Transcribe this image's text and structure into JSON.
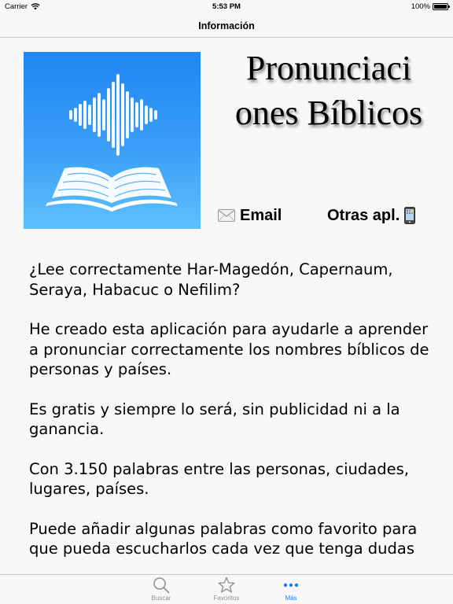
{
  "status_bar": {
    "carrier": "Carrier",
    "time": "5:53 PM",
    "battery": "100%"
  },
  "nav": {
    "title": "Información"
  },
  "app": {
    "title_line1": "Pronunciaci",
    "title_line2": "ones Bíblicos",
    "icon": "book-waveform-icon",
    "icon_colors": [
      "#1f86f3",
      "#5ec0fc"
    ]
  },
  "actions": {
    "email_label": "Email",
    "email_icon": "envelope-icon",
    "other_label": "Otras apl.",
    "other_icon": "phone-icon"
  },
  "description": [
    "¿Lee correctamente Har-Magedón, Capernaum, Seraya, Habacuc o Nefilim?",
    "He creado esta aplicación para ayudarle a aprender a pronunciar correctamente los nombres bíblicos de personas y países.",
    "Es gratis y siempre lo será, sin publicidad ni a la ganancia.",
    "Con 3.150 palabras entre las personas, ciudades, lugares, países.",
    "Puede añadir algunas palabras como favorito para que pueda escucharlos cada vez que tenga dudas"
  ],
  "tabs": [
    {
      "label": "Buscar",
      "icon": "search-icon",
      "active": false
    },
    {
      "label": "Favoritos",
      "icon": "star-icon",
      "active": false
    },
    {
      "label": "Más",
      "icon": "more-icon",
      "active": true
    }
  ],
  "colors": {
    "accent": "#1d7cf2",
    "inactive_tab": "#929292",
    "background": "#f7f7f7"
  }
}
